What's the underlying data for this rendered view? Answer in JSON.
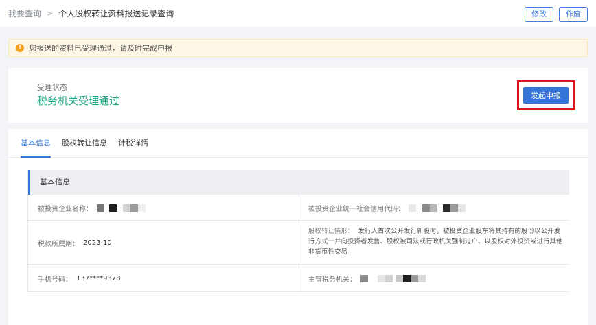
{
  "header": {
    "breadcrumb": [
      "我要查询",
      "个人股权转让资料报送记录查询"
    ],
    "separator": ">",
    "actions": [
      "修改",
      "作废"
    ]
  },
  "notice": {
    "icon": "warning-icon",
    "text": "您报送的资料已受理通过，请及时完成申报"
  },
  "status": {
    "label": "受理状态",
    "value": "税务机关受理通过",
    "value_color": "#1ba784",
    "action": "发起申报",
    "accent": "#3575d8",
    "highlight_color": "#d7191c"
  },
  "tabs": [
    "基本信息",
    "股权转让信息",
    "计税详情"
  ],
  "basic_info": {
    "section_title": "基本信息",
    "fields": {
      "invested_company": "被投资企业名称：",
      "credit_code": "被投资企业统一社会信用代码：",
      "tax_period": "税款所属期：",
      "tax_period_value": "2023-10",
      "transfer_situation": "股权转让情形：",
      "transfer_situation_value": "发行人首次公开发行新股时，被投资企业股东将其持有的股份以公开发行方式一并向投资者发售、股权被司法或行政机关强制过户、以股权对外投资或进行其他非货币性交易",
      "phone": "手机号码：",
      "phone_value": "137****9378",
      "tax_authority": "主管税务机关："
    }
  }
}
